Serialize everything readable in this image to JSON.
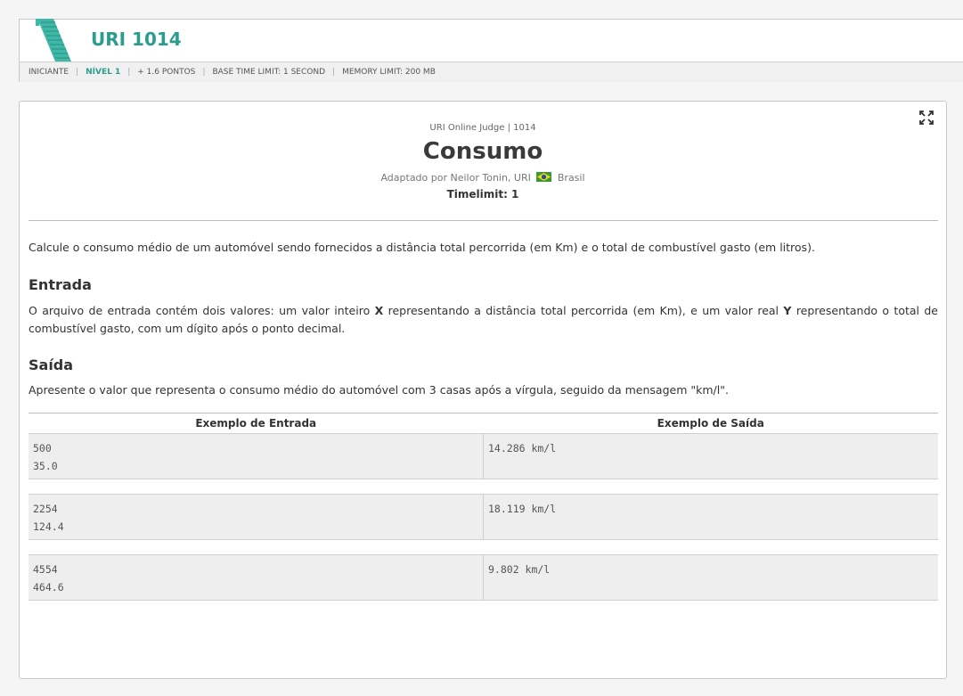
{
  "header": {
    "problem_code": "URI 1014",
    "meta": {
      "category": "INICIANTE",
      "level": "NÍVEL 1",
      "points": "+ 1.6 PONTOS",
      "base_time_limit": "BASE TIME LIMIT: 1 SECOND",
      "memory_limit": "MEMORY LIMIT: 200 MB"
    },
    "accent_color": "#2a9d8f"
  },
  "problem": {
    "judge_line": "URI Online Judge | 1014",
    "title": "Consumo",
    "author_prefix": "Adaptado por Neilor Tonin, URI",
    "author_country": "Brasil",
    "timelimit": "Timelimit: 1",
    "description": "Calcule o consumo médio de um automóvel sendo fornecidos a distância total percorrida (em Km) e o total de combustível gasto (em litros).",
    "input_heading": "Entrada",
    "input_text": {
      "part1": "O arquivo de entrada contém dois valores: um valor inteiro ",
      "var_x": "X",
      "part2": " representando a distância total percorrida (em Km), e um valor real ",
      "var_y": "Y",
      "part3": " representando o total de combustível gasto, com um dígito após o ponto decimal."
    },
    "output_heading": "Saída",
    "output_text": "Apresente o valor que representa o consumo médio do automóvel com 3 casas após a vírgula, seguido da mensagem \"km/l\"."
  },
  "samples": {
    "input_header": "Exemplo de Entrada",
    "output_header": "Exemplo de Saída",
    "rows": [
      {
        "input": "500\n35.0",
        "output": "14.286 km/l"
      },
      {
        "input": "2254\n124.4",
        "output": "18.119 km/l"
      },
      {
        "input": "4554\n464.6",
        "output": "9.802 km/l"
      }
    ]
  },
  "icons": {
    "logo": "uri-logo-icon",
    "fullscreen": "fullscreen-icon",
    "flag": "brazil-flag-icon"
  }
}
